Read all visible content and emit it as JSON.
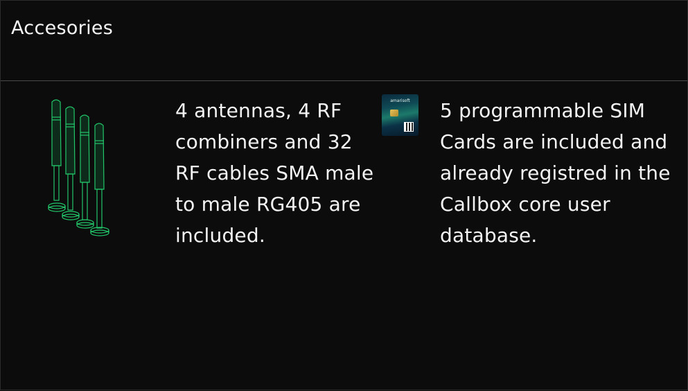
{
  "section": {
    "title": "Accesories"
  },
  "items": [
    {
      "icon": "antennas-icon",
      "text": "4 antennas, 4 RF combiners and 32 RF cables SMA male to male RG405 are included."
    },
    {
      "icon": "sim-card-icon",
      "brand": "amarisoft",
      "text": "5 programmable SIM Cards are included and already registred in the Callbox core user database."
    }
  ],
  "colors": {
    "background": "#0c0c0c",
    "text": "#f4f4f4",
    "accent_green": "#22c76a",
    "divider": "#4a4a4a"
  }
}
